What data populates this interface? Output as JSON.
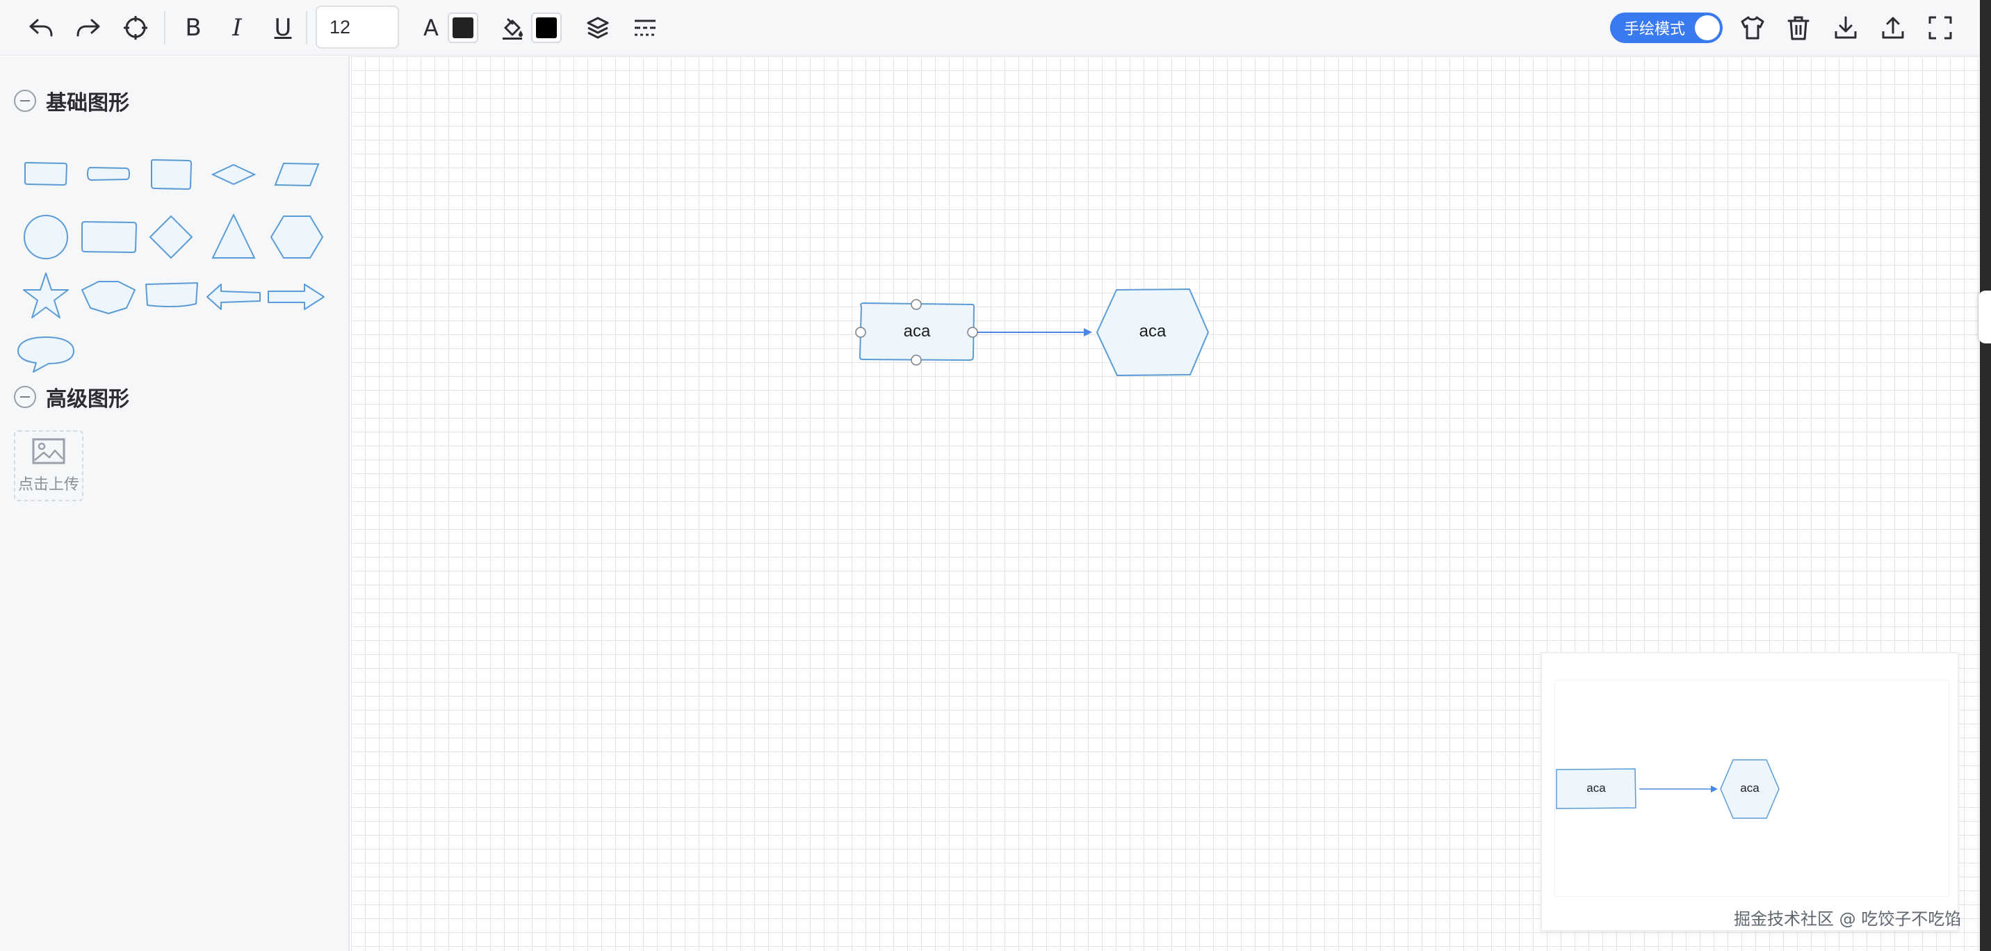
{
  "toolbar": {
    "undo_icon": "undo-icon",
    "redo_icon": "redo-icon",
    "locate_icon": "crosshair-icon",
    "bold_label": "B",
    "italic_label": "I",
    "underline_label": "U",
    "font_size": "12",
    "font_color_label": "A",
    "font_color": "#222222",
    "fill_color": "#000000",
    "layers_icon": "layers-icon",
    "line_style_icon": "line-style-icon",
    "handdrawn_toggle_label": "手绘模式",
    "handdrawn_enabled": true,
    "right_icons": [
      "shirt-icon",
      "trash-icon",
      "download-icon",
      "upload-icon",
      "fullscreen-icon"
    ]
  },
  "sidebar": {
    "basic_shapes_title": "基础图形",
    "advanced_shapes_title": "高级图形",
    "upload_label": "点击上传",
    "basic_shapes": [
      "rect",
      "rounded-rect",
      "square",
      "diamond-flat",
      "parallelogram",
      "circle",
      "wide-rect",
      "diamond",
      "triangle",
      "hexagon",
      "star",
      "pentagon-wide",
      "trapezoid",
      "double-arrow",
      "right-arrow",
      "speech-bubble"
    ]
  },
  "canvas": {
    "node1_text": "aca",
    "node2_text": "aca",
    "shape_stroke": "#5b9bd5",
    "shape_fill": "#eef6fd",
    "edge_color": "#4a86e8"
  },
  "minimap": {
    "node1_text": "aca",
    "node2_text": "aca"
  },
  "watermark": "掘金技术社区 @ 吃饺子不吃馅"
}
